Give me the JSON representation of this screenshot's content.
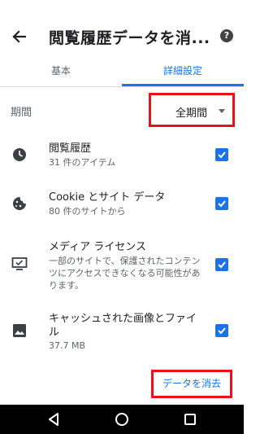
{
  "header": {
    "title": "閲覧履歴データを消...",
    "help_label": "?"
  },
  "tabs": [
    {
      "label": "基本"
    },
    {
      "label": "詳細設定"
    }
  ],
  "period": {
    "label": "期間",
    "value": "全期間"
  },
  "items": [
    {
      "title": "閲覧履歴",
      "subtitle": "31 件のアイテム",
      "icon": "clock-icon",
      "checked": true
    },
    {
      "title": "Cookie とサイト データ",
      "subtitle": "80 件のサイトから",
      "icon": "cookie-icon",
      "checked": true
    },
    {
      "title": "メディア ライセンス",
      "subtitle": "一部のサイトで、保護されたコンテンツにアクセスできなくなる可能性があります。",
      "icon": "media-license-icon",
      "checked": true
    },
    {
      "title": "キャッシュされた画像とファイル",
      "subtitle": "37.7 MB",
      "icon": "image-icon",
      "checked": true
    }
  ],
  "clear_button": {
    "label": "データを消去"
  },
  "colors": {
    "accent": "#1a73e8",
    "highlight": "#e8131a"
  }
}
